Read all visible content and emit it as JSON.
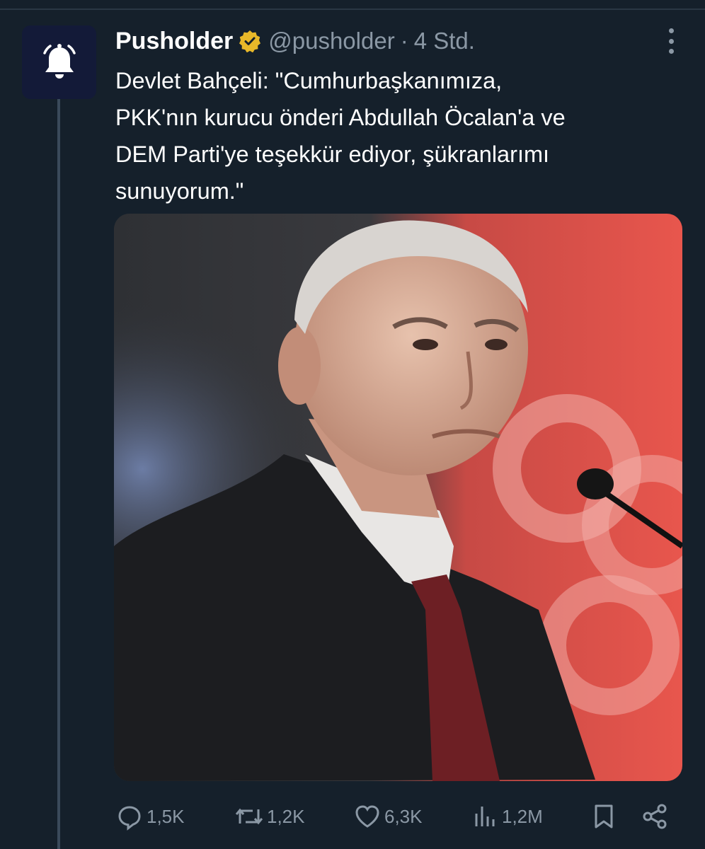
{
  "tweet": {
    "author_name": "Pusholder",
    "handle": "@pusholder",
    "separator": "·",
    "time": "4 Std.",
    "text_lines": [
      "Devlet Bahçeli: \"Cumhurbaşkanımıza,",
      "PKK'nın kurucu önderi Abdullah Öcalan'a ve",
      "DEM Parti'ye teşekkür ediyor, şükranlarımı",
      "sunuyorum.\""
    ]
  },
  "stats": {
    "replies": "1,5K",
    "reposts": "1,2K",
    "likes": "6,3K",
    "views": "1,2M"
  },
  "icons": {
    "avatar": "bell-icon",
    "verified": "verified-badge-icon",
    "more": "more-options-icon",
    "reply": "reply-icon",
    "repost": "repost-icon",
    "like": "heart-icon",
    "views": "views-chart-icon",
    "bookmark": "bookmark-icon",
    "share": "share-icon"
  },
  "colors": {
    "background": "#15202b",
    "muted_text": "#8b98a5",
    "verified_gold": "#e8b829",
    "avatar_bg": "#131a38"
  }
}
